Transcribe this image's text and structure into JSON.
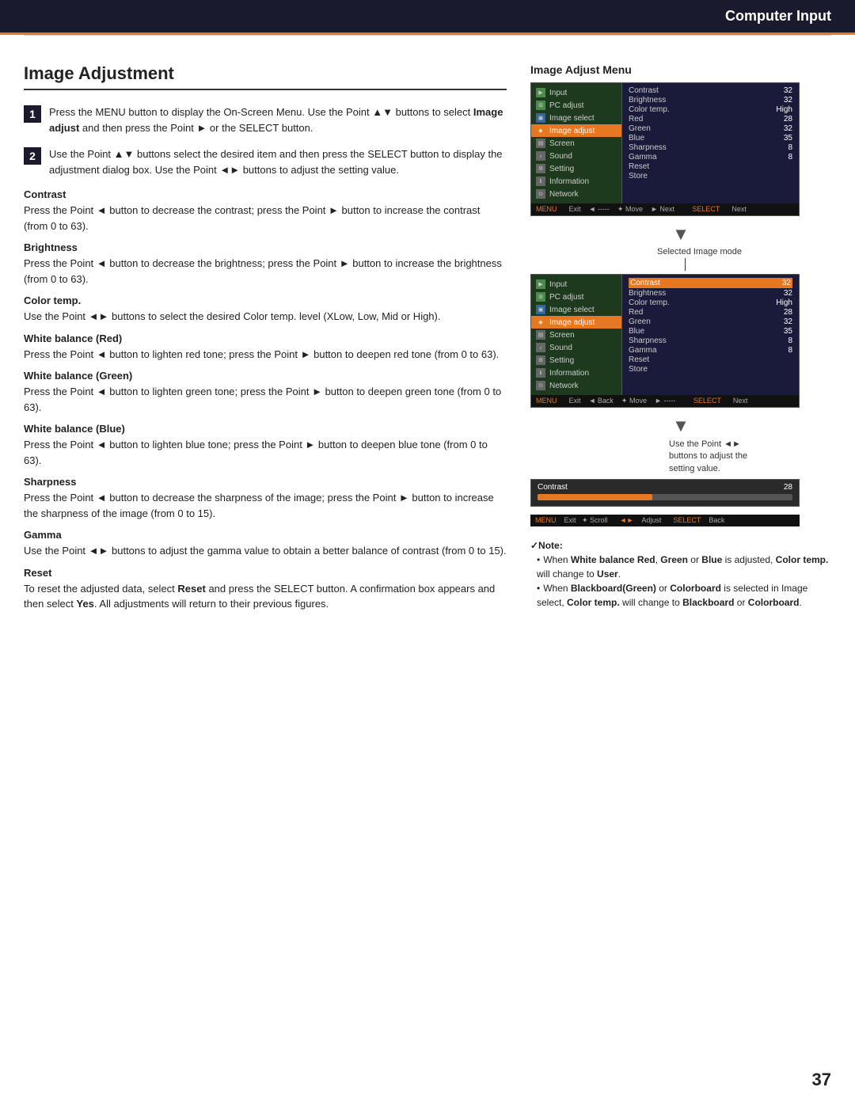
{
  "header": {
    "title": "Computer Input"
  },
  "page": {
    "title": "Image Adjustment",
    "step1": {
      "text": "Press the MENU button to display the On-Screen Menu. Use the Point ▲▼ buttons to select ",
      "bold1": "Image adjust",
      "text2": " and then press the Point ► or the SELECT button."
    },
    "step2": {
      "text": "Use the Point ▲▼ buttons select the desired item and then press the SELECT button to display the adjustment dialog box. Use the Point ◄► buttons to adjust the setting value."
    },
    "sections": [
      {
        "title": "Contrast",
        "body": "Press the Point ◄ button to decrease the contrast; press the Point ► button to increase the contrast (from 0 to 63)."
      },
      {
        "title": "Brightness",
        "body": "Press the Point ◄ button to decrease the brightness; press the Point ► button to increase the brightness (from 0 to 63)."
      },
      {
        "title": "Color temp.",
        "body": "Use the Point ◄► buttons to select the desired Color temp. level (XLow, Low, Mid or High)."
      },
      {
        "title": "White balance (Red)",
        "body": "Press the Point ◄ button to lighten red tone; press the Point ► button to deepen red tone (from 0 to 63)."
      },
      {
        "title": "White balance (Green)",
        "body": "Press the Point ◄ button to lighten green tone; press the Point ► button to deepen green tone (from 0 to 63)."
      },
      {
        "title": "White balance (Blue)",
        "body": "Press the Point ◄ button to lighten blue tone; press the Point ► button to deepen blue tone (from 0 to 63)."
      },
      {
        "title": "Sharpness",
        "body": "Press the Point ◄ button to decrease the sharpness of the image; press the Point ► button to increase the sharpness of the image (from 0 to 15)."
      },
      {
        "title": "Gamma",
        "body": "Use the Point ◄► buttons to adjust the gamma value to obtain a better balance of contrast (from 0 to 15)."
      },
      {
        "title": "Reset",
        "body": "To reset the adjusted data, select Reset and press the SELECT button. A confirmation box appears and then select Yes. All adjustments will return to their previous figures."
      }
    ]
  },
  "right": {
    "menu_title": "Image Adjust Menu",
    "menu1": {
      "left_items": [
        "Input",
        "PC adjust",
        "Image select",
        "Image adjust",
        "Screen",
        "Sound",
        "Setting",
        "Information",
        "Network"
      ],
      "right_items": [
        {
          "label": "Contrast",
          "value": "32"
        },
        {
          "label": "Brightness",
          "value": "32"
        },
        {
          "label": "Color temp.",
          "value": "High"
        },
        {
          "label": "Red",
          "value": "28"
        },
        {
          "label": "Green",
          "value": "32"
        },
        {
          "label": "Blue",
          "value": "35"
        },
        {
          "label": "Sharpness",
          "value": "8"
        },
        {
          "label": "Gamma",
          "value": "8"
        },
        {
          "label": "Reset",
          "value": ""
        },
        {
          "label": "Store",
          "value": ""
        }
      ],
      "bar": "MENU Exit    ◄ -----    ✦ Move    ► Next    SELECT Next"
    },
    "annotation": "Selected Image mode",
    "menu2": {
      "left_items": [
        "Input",
        "PC adjust",
        "Image select",
        "Image adjust",
        "Screen",
        "Sound",
        "Setting",
        "Information",
        "Network"
      ],
      "right_items": [
        {
          "label": "Contrast",
          "value": "32",
          "highlight": true
        },
        {
          "label": "Brightness",
          "value": "32"
        },
        {
          "label": "Color temp.",
          "value": "High"
        },
        {
          "label": "Red",
          "value": "28"
        },
        {
          "label": "Green",
          "value": "32"
        },
        {
          "label": "Blue",
          "value": "35"
        },
        {
          "label": "Sharpness",
          "value": "8"
        },
        {
          "label": "Gamma",
          "value": "8"
        },
        {
          "label": "Reset",
          "value": ""
        },
        {
          "label": "Store",
          "value": ""
        }
      ],
      "bar": "MENU Exit    ◄ Back    ✦ Move    ► -----    SELECT Next"
    },
    "use_point_text": "Use the Point ◄►\nbuttons to adjust the\nsetting value.",
    "slider": {
      "label": "Contrast",
      "value": "28",
      "bar": "MENU Exit    ✦ Scroll    ◄► Adjust    SELECT Back"
    },
    "note": {
      "title": "✓Note:",
      "items": [
        "When White balance Red, Green or Blue is adjusted, Color temp. will change to User.",
        "When Blackboard(Green) or Colorboard is selected in Image select, Color temp. will change to Blackboard or Colorboard."
      ]
    }
  },
  "footer": {
    "page_number": "37"
  }
}
